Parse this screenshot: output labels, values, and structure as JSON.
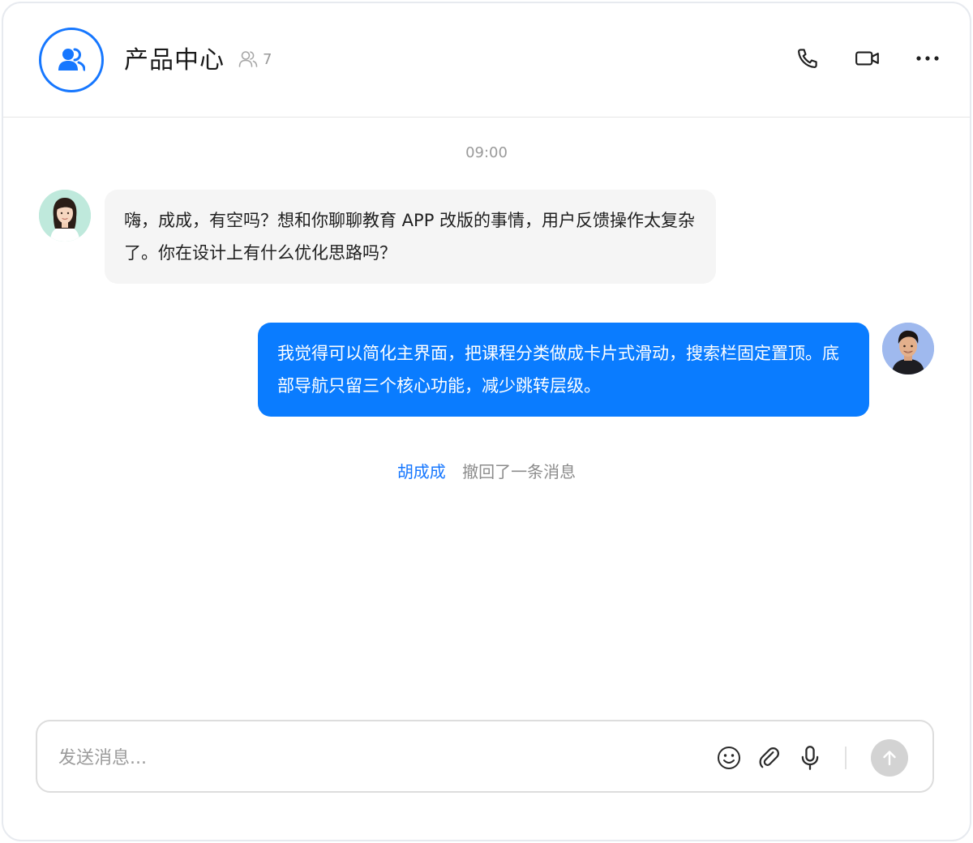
{
  "header": {
    "group_name": "产品中心",
    "member_count": "7"
  },
  "chat": {
    "timestamp": "09:00",
    "messages": [
      {
        "side": "left",
        "text": "嗨，成成，有空吗？想和你聊聊教育 APP 改版的事情，用户反馈操作太复杂了。你在设计上有什么优化思路吗？"
      },
      {
        "side": "right",
        "text": "我觉得可以简化主界面，把课程分类做成卡片式滑动，搜索栏固定置顶。底部导航只留三个核心功能，减少跳转层级。"
      }
    ],
    "recall": {
      "name": "胡成成",
      "text": "撤回了一条消息"
    }
  },
  "composer": {
    "placeholder": "发送消息..."
  },
  "colors": {
    "accent": "#1677ff",
    "outgoing_bubble": "#0a7cff",
    "incoming_bubble": "#f5f5f5"
  }
}
